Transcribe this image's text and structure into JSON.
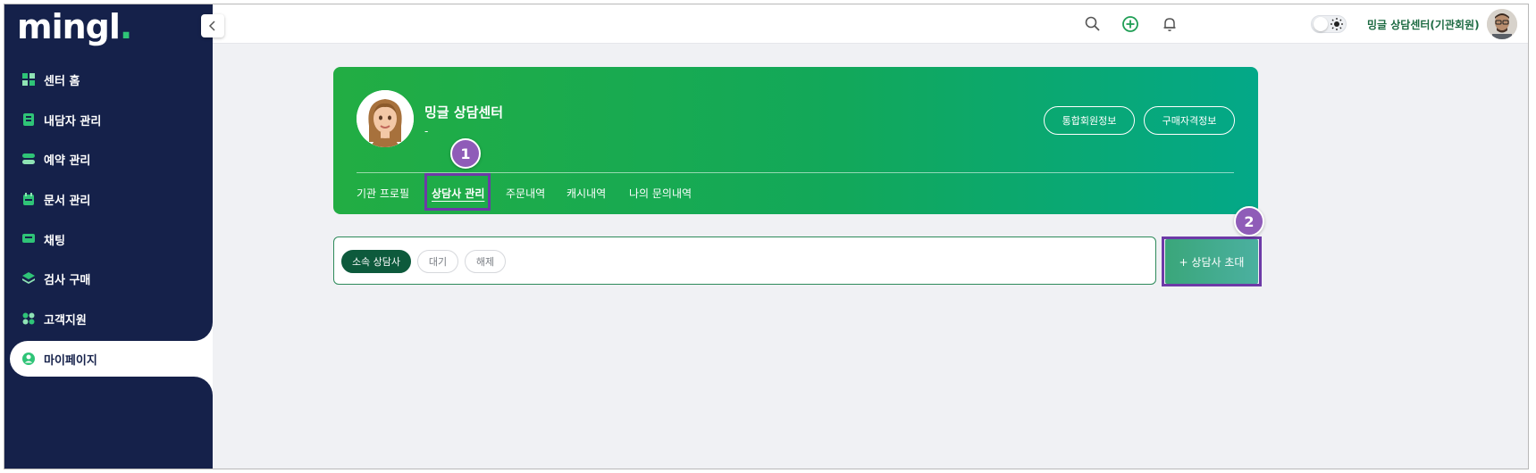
{
  "logo": {
    "text": "mingl",
    "dot": "."
  },
  "sidebar": {
    "items": [
      {
        "label": "센터 홈"
      },
      {
        "label": "내담자 관리"
      },
      {
        "label": "예약 관리"
      },
      {
        "label": "문서 관리"
      },
      {
        "label": "채팅"
      },
      {
        "label": "검사 구매"
      },
      {
        "label": "고객지원"
      },
      {
        "label": "마이페이지"
      }
    ]
  },
  "header": {
    "user_name": "밍글 상담센터(기관회원)"
  },
  "profile": {
    "name": "밍글 상담센터",
    "subtitle": "-",
    "buttons": {
      "member_info": "통합회원정보",
      "qualification_info": "구매자격정보"
    },
    "tabs": [
      {
        "label": "기관 프로필"
      },
      {
        "label": "상담사 관리"
      },
      {
        "label": "주문내역"
      },
      {
        "label": "캐시내역"
      },
      {
        "label": "나의 문의내역"
      }
    ]
  },
  "filters": [
    {
      "label": "소속 상담사"
    },
    {
      "label": "대기"
    },
    {
      "label": "해제"
    }
  ],
  "invite_button": "+ 상담사 초대",
  "annotations": {
    "step1": "1",
    "step2": "2"
  },
  "colors": {
    "sidebar_bg": "#15214a",
    "accent_green": "#22ad43",
    "highlight_purple": "#6d3aa7",
    "badge_purple": "#8f5cb8"
  }
}
